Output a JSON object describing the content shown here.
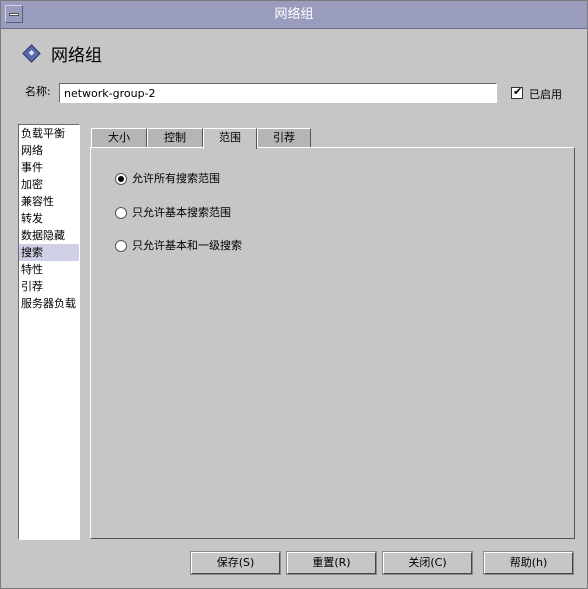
{
  "window": {
    "title": "网络组"
  },
  "header": {
    "title": "网络组"
  },
  "name_field": {
    "label": "名称:",
    "value": "network-group-2"
  },
  "enabled": {
    "label": "已启用",
    "checked": true
  },
  "sidebar": {
    "items": [
      {
        "label": "负载平衡"
      },
      {
        "label": "网络"
      },
      {
        "label": "事件"
      },
      {
        "label": "加密"
      },
      {
        "label": "兼容性"
      },
      {
        "label": "转发"
      },
      {
        "label": "数据隐藏"
      },
      {
        "label": "搜索",
        "selected": true
      },
      {
        "label": "特性"
      },
      {
        "label": "引荐"
      },
      {
        "label": "服务器负载"
      }
    ]
  },
  "tabs": [
    {
      "label": "大小"
    },
    {
      "label": "控制"
    },
    {
      "label": "范围",
      "active": true
    },
    {
      "label": "引荐"
    }
  ],
  "scope": {
    "options": [
      {
        "label": "允许所有搜索范围",
        "selected": true
      },
      {
        "label": "只允许基本搜索范围",
        "selected": false
      },
      {
        "label": "只允许基本和一级搜索",
        "selected": false
      }
    ]
  },
  "buttons": {
    "save": "保存(S)",
    "reset": "重置(R)",
    "close": "关闭(C)",
    "help": "帮助(h)"
  }
}
